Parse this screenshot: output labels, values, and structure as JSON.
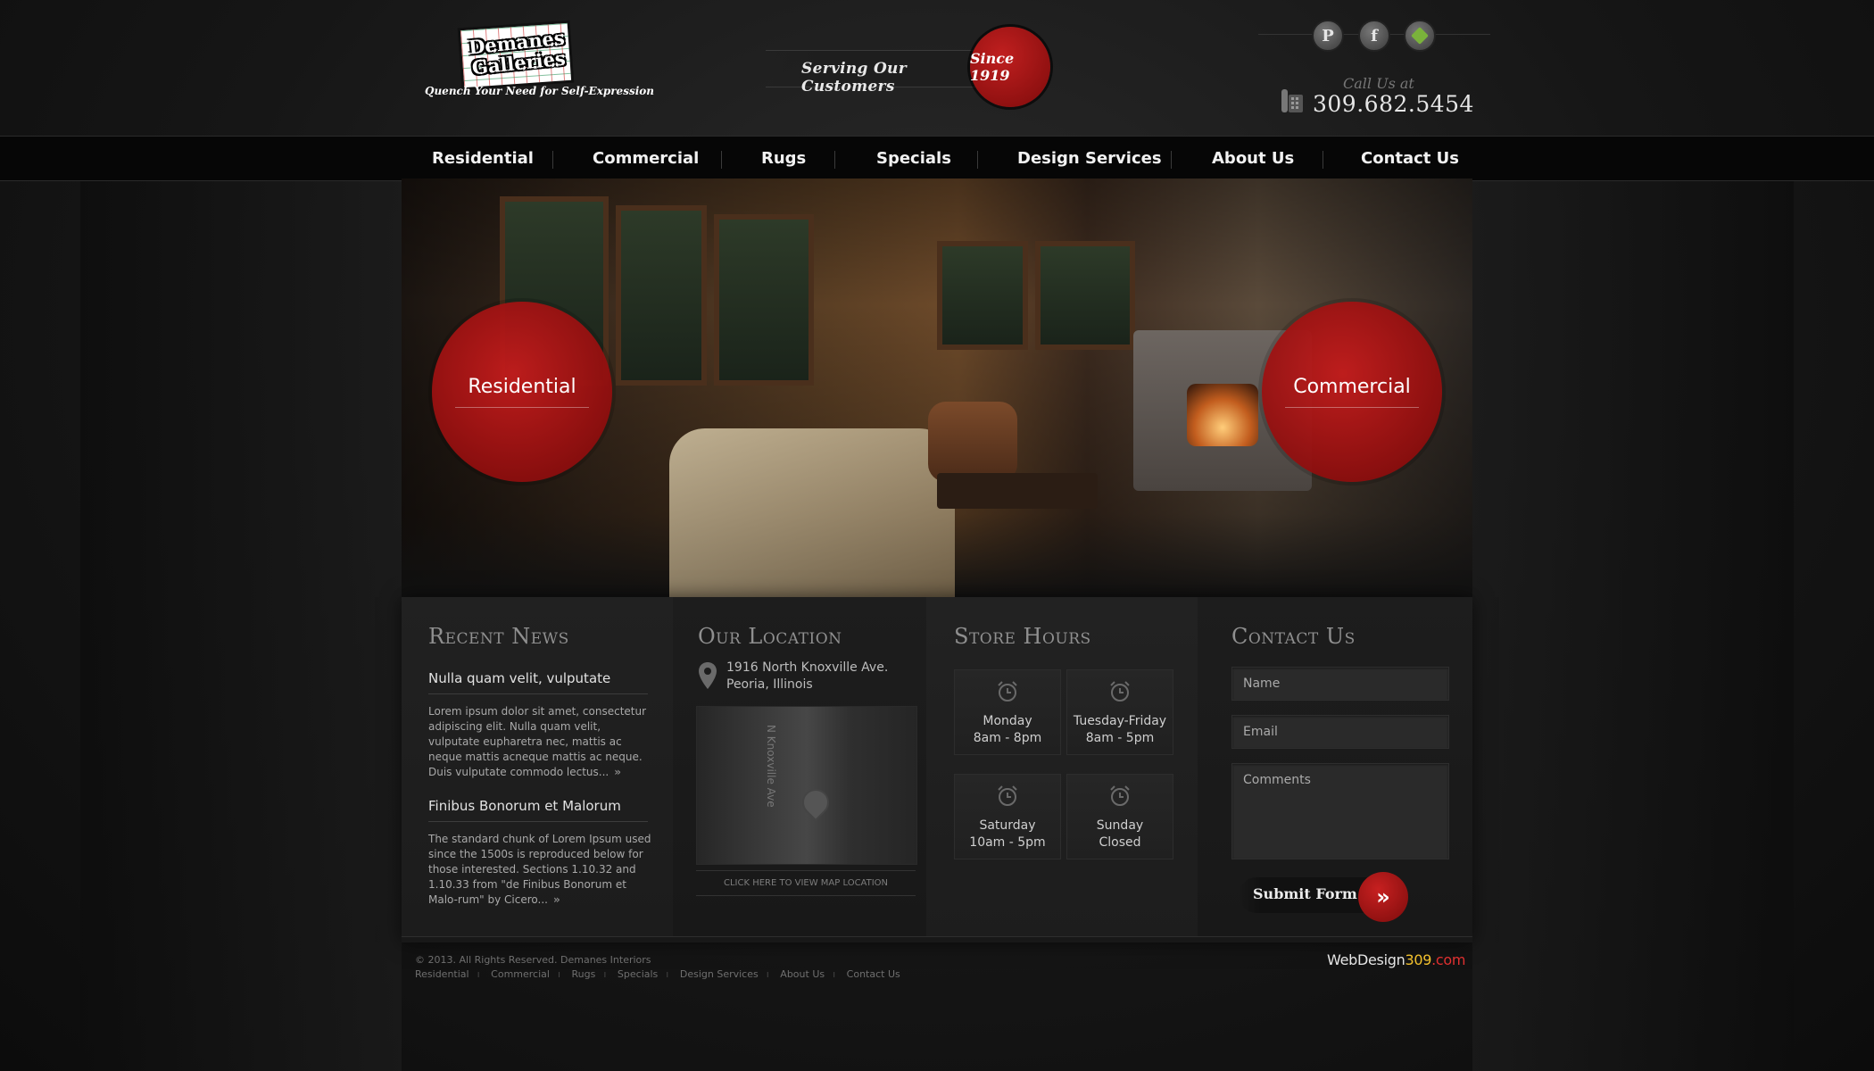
{
  "header": {
    "logo": {
      "name_line1": "Demanes",
      "name_line2": "Galleries",
      "tagline": "Quench Your Need for Self-Expression"
    },
    "serving_text": "Serving Our Customers",
    "since_badge": "Since 1919",
    "social": [
      {
        "label": "P",
        "icon": "pinterest-icon"
      },
      {
        "label": "f",
        "icon": "facebook-icon"
      },
      {
        "label": "",
        "icon": "houzz-icon"
      }
    ],
    "call_label": "Call Us at",
    "phone": "309.682.5454"
  },
  "nav": {
    "items": [
      {
        "label": "Residential"
      },
      {
        "label": "Commercial"
      },
      {
        "label": "Rugs"
      },
      {
        "label": "Specials"
      },
      {
        "label": "Design Services"
      },
      {
        "label": "About Us"
      },
      {
        "label": "Contact Us"
      }
    ]
  },
  "hero": {
    "left_circle": "Residential",
    "right_circle": "Commercial"
  },
  "recent_news": {
    "title": "Recent News",
    "items": [
      {
        "title": "Nulla quam velit, vulputate",
        "body": "Lorem ipsum dolor sit amet, consectetur adipiscing elit. Nulla quam velit, vulputate eupharetra nec, mattis ac neque mattis acneque mattis ac neque. Duis vulputate commodo lectus...",
        "more": "»"
      },
      {
        "title": "Finibus Bonorum et Malorum",
        "body": "The standard chunk of Lorem Ipsum used since the 1500s is reproduced below for those interested. Sections 1.10.32 and 1.10.33 from \"de Finibus Bonorum et Malo-rum\" by Cicero...",
        "more": "»"
      }
    ]
  },
  "location": {
    "title": "Our Location",
    "address_line1": "1916 North Knoxville Ave.",
    "address_line2": "Peoria, Illinois",
    "map_street": "N Knoxville Ave",
    "map_link": "CLICK HERE TO VIEW MAP LOCATION"
  },
  "hours": {
    "title": "Store Hours",
    "items": [
      {
        "day": "Monday",
        "time": "8am - 8pm"
      },
      {
        "day": "Tuesday-Friday",
        "time": "8am - 5pm"
      },
      {
        "day": "Saturday",
        "time": "10am - 5pm"
      },
      {
        "day": "Sunday",
        "time": "Closed"
      }
    ]
  },
  "contact": {
    "title": "Contact Us",
    "name_placeholder": "Name",
    "email_placeholder": "Email",
    "comments_placeholder": "Comments",
    "submit_label": "Submit Form",
    "submit_icon": "»"
  },
  "footer": {
    "copyright": "© 2013. All Rights Reserved. Demanes Interiors",
    "links": [
      "Residential",
      "Commercial",
      "Rugs",
      "Specials",
      "Design Services",
      "About Us",
      "Contact Us"
    ],
    "credit_a": "WebDesign",
    "credit_b": "309",
    "credit_c": ".com"
  },
  "colors": {
    "accent_red": "#b51818",
    "background": "#111111",
    "nav_bg": "#060606"
  }
}
